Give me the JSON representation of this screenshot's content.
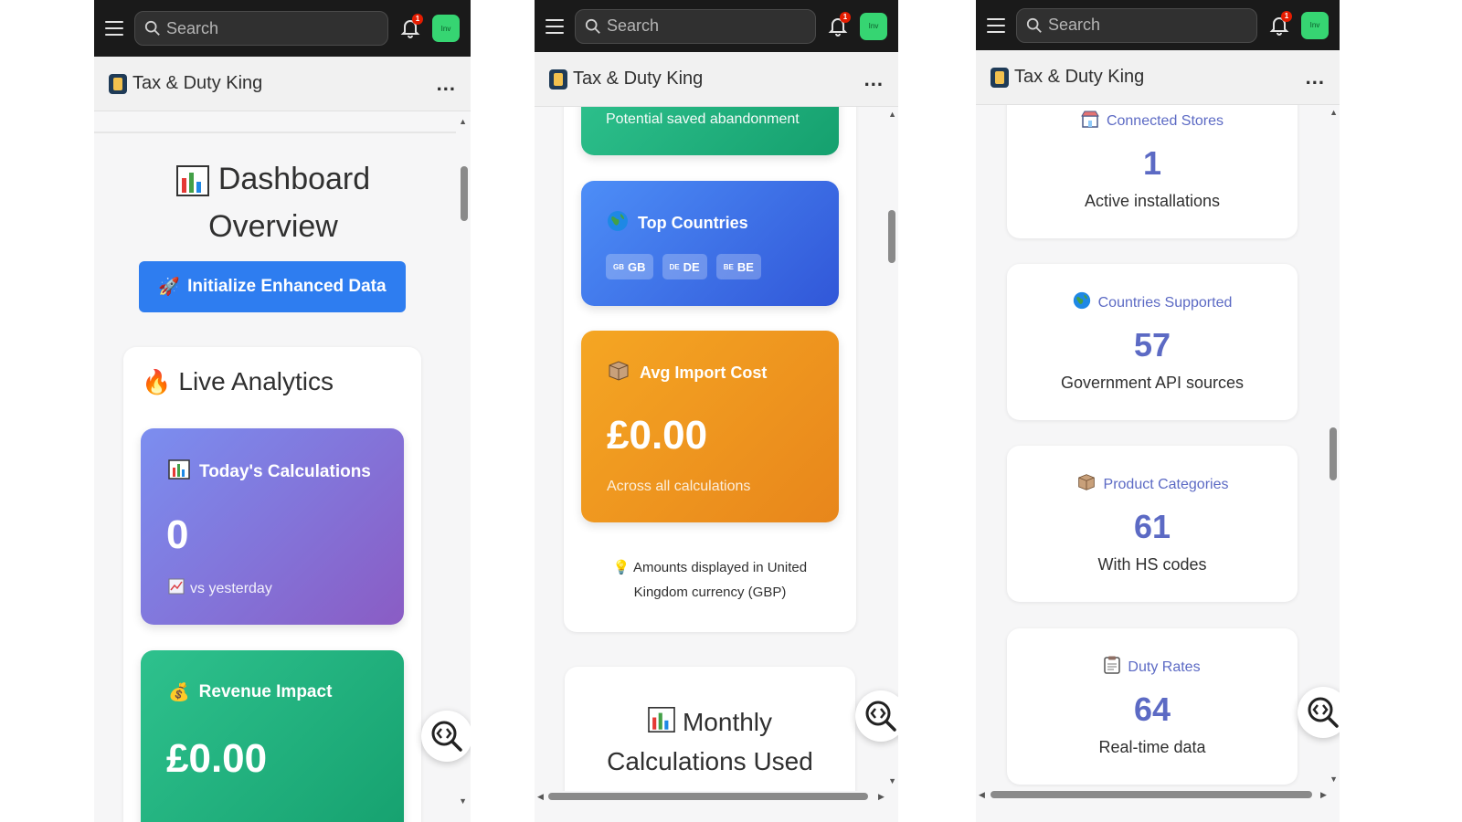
{
  "topbar": {
    "search_placeholder": "Search",
    "notification_count": "1",
    "avatar_text": "Inv"
  },
  "app": {
    "title": "Tax & Duty King",
    "menu": "..."
  },
  "panel1": {
    "heading_line1": "Dashboard",
    "heading_line2": "Overview",
    "init_button": "Initialize Enhanced Data",
    "live_analytics_title": "Live Analytics",
    "todays_calculations": {
      "label": "Today's Calculations",
      "value": "0",
      "comparison": "vs yesterday"
    },
    "revenue_impact": {
      "label": "Revenue Impact",
      "value": "£0.00"
    }
  },
  "panel2": {
    "abandonment_text": "Potential saved abandonment",
    "top_countries": {
      "label": "Top Countries",
      "countries": [
        {
          "flag": "GB",
          "code": "GB"
        },
        {
          "flag": "DE",
          "code": "DE"
        },
        {
          "flag": "BE",
          "code": "BE"
        }
      ]
    },
    "avg_import_cost": {
      "label": "Avg Import Cost",
      "value": "£0.00",
      "sub": "Across all calculations"
    },
    "currency_note_line1": "Amounts displayed in United",
    "currency_note_line2": "Kingdom currency (GBP)",
    "monthly_title_line1": "Monthly",
    "monthly_title_line2": "Calculations Used"
  },
  "panel3": {
    "stats": [
      {
        "label": "Connected Stores",
        "value": "1",
        "sub": "Active installations",
        "icon": "store-icon"
      },
      {
        "label": "Countries Supported",
        "value": "57",
        "sub": "Government API sources",
        "icon": "globe-icon"
      },
      {
        "label": "Product Categories",
        "value": "61",
        "sub": "With HS codes",
        "icon": "box-icon"
      },
      {
        "label": "Duty Rates",
        "value": "64",
        "sub": "Real-time data",
        "icon": "clipboard-icon"
      }
    ]
  },
  "colors": {
    "accent": "#5c6ac4",
    "button_blue": "#2e7df0",
    "topbar": "#1a1a1a",
    "avatar": "#36d572"
  }
}
